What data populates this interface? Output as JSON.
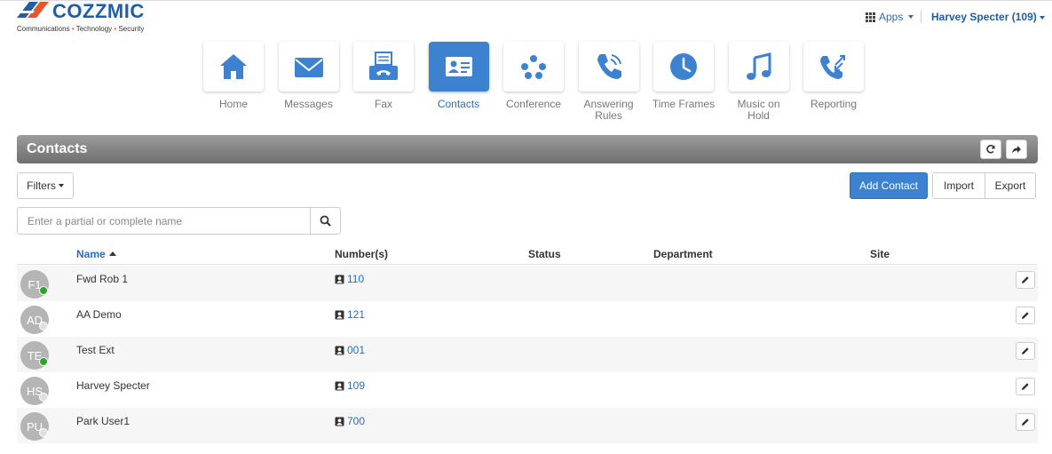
{
  "brand": {
    "name": "COZZMIC",
    "tagline_parts": [
      "Communications",
      "Technology",
      "Security"
    ],
    "tagline_sep": "•",
    "colors": {
      "blue": "#1d5fa8",
      "orange": "#e8562a"
    }
  },
  "header": {
    "apps_label": "Apps",
    "user_label": "Harvey Specter (109)"
  },
  "nav": {
    "home": "Home",
    "messages": "Messages",
    "fax": "Fax",
    "contacts": "Contacts",
    "conference": "Conference",
    "answering_rules": "Answering Rules",
    "time_frames": "Time Frames",
    "music_on_hold": "Music on Hold",
    "reporting": "Reporting",
    "active": "contacts",
    "active_color": "#3d82d1",
    "icon_color": "#3d82d1"
  },
  "panel": {
    "title": "Contacts",
    "refresh_icon": "refresh-icon",
    "share_icon": "share-icon"
  },
  "toolbar": {
    "filters_label": "Filters",
    "add_contact_label": "Add Contact",
    "import_label": "Import",
    "export_label": "Export",
    "search_placeholder": "Enter a partial or complete name"
  },
  "table": {
    "columns": {
      "name": "Name",
      "numbers": "Number(s)",
      "status": "Status",
      "department": "Department",
      "site": "Site"
    },
    "rows": [
      {
        "initials": "F1",
        "name": "Fwd Rob 1",
        "number": "110",
        "presence": "online"
      },
      {
        "initials": "AD",
        "name": "AA Demo",
        "number": "121",
        "presence": "offline"
      },
      {
        "initials": "TE",
        "name": "Test Ext",
        "number": "001",
        "presence": "online"
      },
      {
        "initials": "HS",
        "name": "Harvey Specter",
        "number": "109",
        "presence": "offline"
      },
      {
        "initials": "PU",
        "name": "Park User1",
        "number": "700",
        "presence": "offline"
      }
    ],
    "presence_colors": {
      "online": "#2aa52a",
      "offline": "#e0e0e0"
    }
  }
}
